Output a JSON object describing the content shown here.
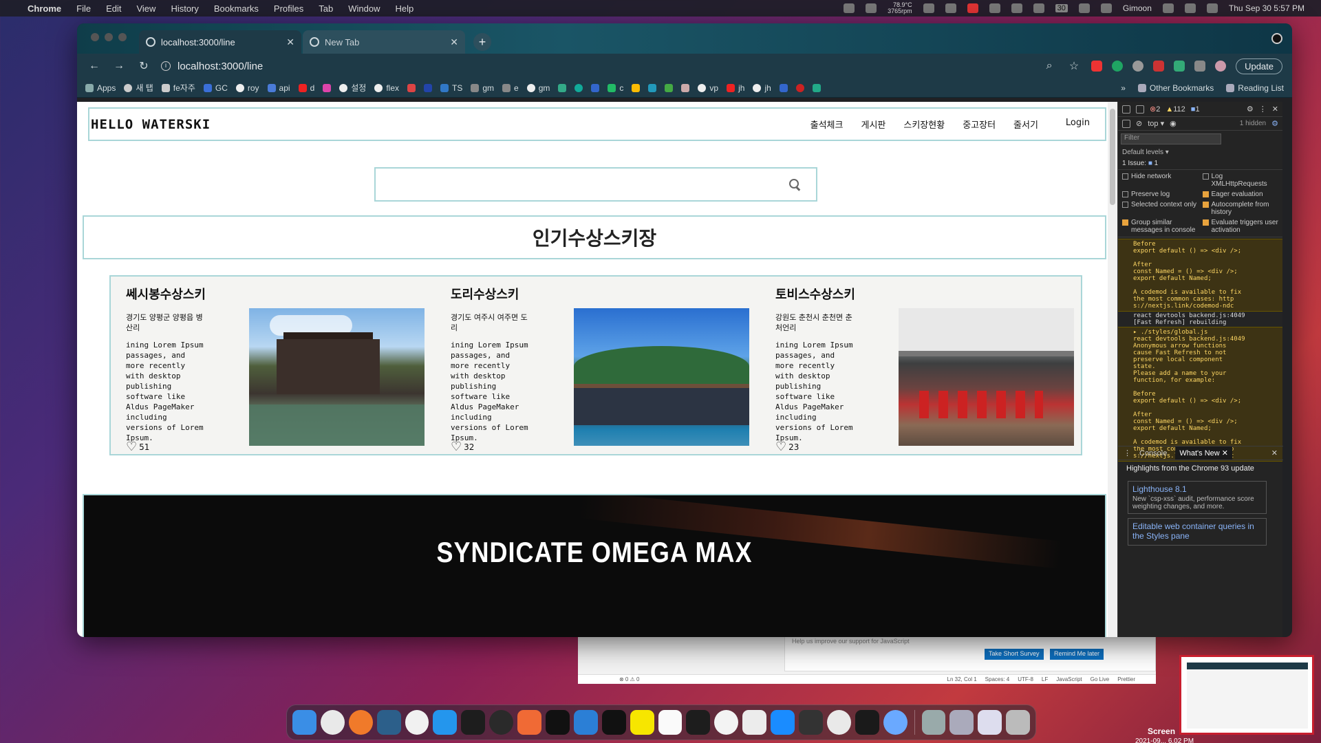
{
  "menubar": {
    "app_name": "Chrome",
    "items": [
      "File",
      "Edit",
      "View",
      "History",
      "Bookmarks",
      "Profiles",
      "Tab",
      "Window",
      "Help"
    ],
    "temp": "78.9°C",
    "rpm": "3765rpm",
    "battery_num": "30",
    "user": "Gimoon",
    "datetime": "Thu Sep 30  5:57 PM"
  },
  "browser": {
    "tabs": [
      {
        "title": "localhost:3000/line",
        "active": true
      },
      {
        "title": "New Tab",
        "active": false
      }
    ],
    "url": "localhost:3000/line",
    "update_label": "Update",
    "bookmarks": [
      "Apps",
      "새 탭",
      "fe자주",
      "GC",
      "roy",
      "api",
      "d",
      "설정",
      "flex",
      "",
      "",
      "TS",
      "gm",
      "e",
      "gm",
      "",
      "",
      "",
      "c",
      "",
      "",
      "",
      "",
      "vp",
      "jh",
      "jh",
      "",
      "",
      "",
      "",
      ""
    ],
    "bookmarks_right": [
      "Other Bookmarks",
      "Reading List"
    ]
  },
  "site": {
    "logo": "HELLO WATERSKI",
    "nav": [
      "출석체크",
      "게시판",
      "스키장현황",
      "중고장터",
      "줄서기"
    ],
    "login": "Login",
    "search_placeholder": "",
    "section_title": "인기수상스키장",
    "cards": [
      {
        "name": "쎄시봉수상스키",
        "address": "경기도 양평군 양평읍 병산리",
        "desc": "ining Lorem Ipsum passages, and more recently with desktop publishing software like Aldus PageMaker including versions of Lorem Ipsum.",
        "likes": "51"
      },
      {
        "name": "도리수상스키",
        "address": "경기도 여주시 여주면 도리",
        "desc": "ining Lorem Ipsum passages, and more recently with desktop publishing software like Aldus PageMaker including versions of Lorem Ipsum.",
        "likes": "32"
      },
      {
        "name": "토비스수상스키",
        "address": "강원도 춘천시 춘천면 춘처언리",
        "desc": "ining Lorem Ipsum passages, and more recently with desktop publishing software like Aldus PageMaker including versions of Lorem Ipsum.",
        "likes": "23"
      }
    ],
    "banner_text": "SYNDICATE OMEGA MAX"
  },
  "devtools": {
    "errors": "2",
    "warnings": "112",
    "infos": "1",
    "context": "top",
    "hidden": "1 hidden",
    "filter_placeholder": "Filter",
    "levels": "Default levels",
    "issues": "1 Issue:",
    "issues_count": "1",
    "settings": [
      {
        "label": "Hide network",
        "checked": false
      },
      {
        "label": "Log XMLHttpRequests",
        "checked": false
      },
      {
        "label": "Preserve log",
        "checked": false
      },
      {
        "label": "Eager evaluation",
        "checked": true
      },
      {
        "label": "Selected context only",
        "checked": false
      },
      {
        "label": "Autocomplete from history",
        "checked": true
      },
      {
        "label": "Group similar messages in console",
        "checked": true
      },
      {
        "label": "Evaluate triggers user activation",
        "checked": true
      }
    ],
    "console_lines": [
      "Before\nexport default () => <div />;\n\nAfter\nconst Named = () => <div />;\nexport default Named;\n\nA codemod is available to fix\nthe most common cases: http\ns://nextjs.link/codemod-ndc",
      "react devtools backend.js:4049\n[Fast Refresh] rebuilding",
      "▸ ./styles/global.js\nreact devtools backend.js:4049\nAnonymous arrow functions\ncause Fast Refresh to not\npreserve local component\nstate.\nPlease add a name to your\nfunction, for example:\n\nBefore\nexport default () => <div />;\n\nAfter\nconst Named = () => <div />;\nexport default Named;\n\nA codemod is available to fix\nthe most common cases: http\ns://nextjs.link/codemod-ndc"
    ],
    "drawer_tabs": [
      "Console",
      "What's New"
    ],
    "highlights": "Highlights from the Chrome 93 update",
    "whats_new": [
      {
        "title": "Lighthouse 8.1",
        "desc": "New `csp-xss` audit, performance score weighting changes, and more."
      },
      {
        "title": "Editable web container queries in the Styles pane",
        "desc": ""
      }
    ]
  },
  "vscode": {
    "notice": "Help us improve our support for JavaScript",
    "btn_survey": "Take Short Survey",
    "btn_remind": "Remind Me later",
    "status_left": "⊗ 0 ⚠ 0",
    "status_right": [
      "Ln 32, Col 1",
      "Spaces: 4",
      "UTF-8",
      "LF",
      "JavaScript",
      "Go Live",
      "Prettier"
    ]
  },
  "screenshot": {
    "label": "Screen",
    "date": "2021-09... 6.02 PM"
  }
}
